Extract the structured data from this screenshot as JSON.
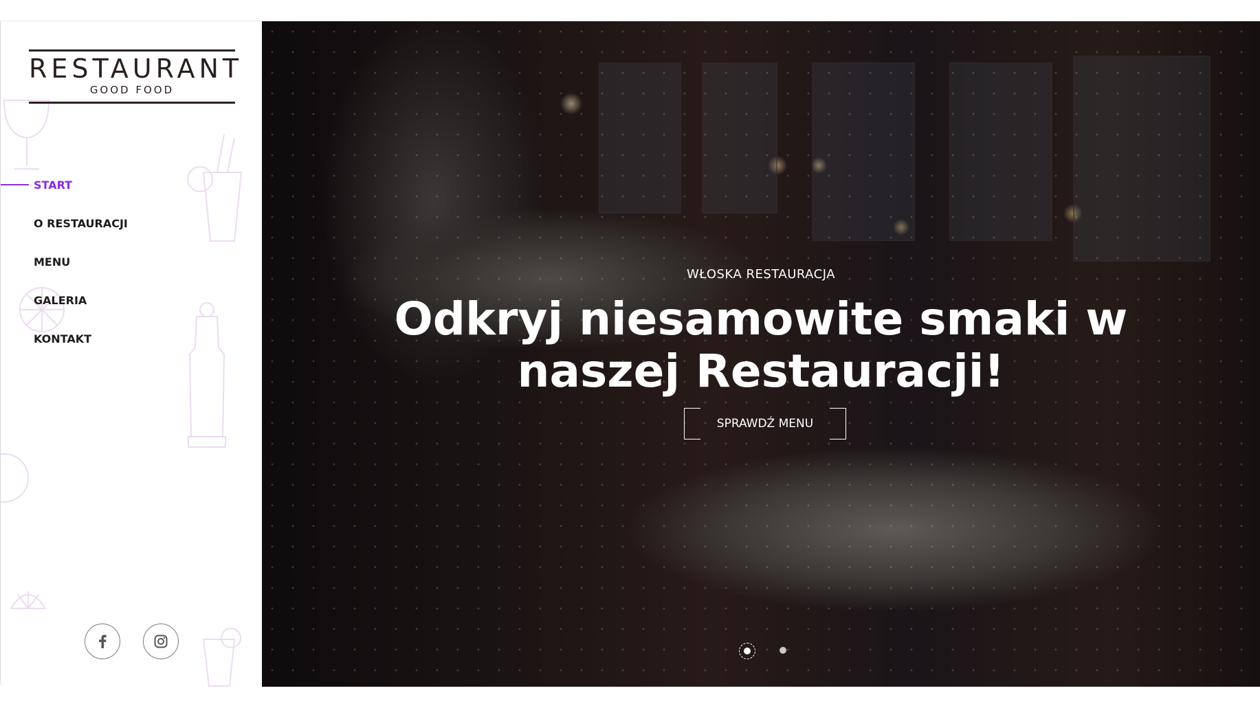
{
  "brand": {
    "name": "RESTAURANT",
    "tagline": "GOOD FOOD"
  },
  "nav": {
    "items": [
      {
        "label": "START",
        "active": true
      },
      {
        "label": "O RESTAURACJI",
        "active": false
      },
      {
        "label": "MENU",
        "active": false
      },
      {
        "label": "GALERIA",
        "active": false
      },
      {
        "label": "KONTAKT",
        "active": false
      }
    ]
  },
  "social": {
    "items": [
      {
        "icon": "facebook-icon"
      },
      {
        "icon": "instagram-icon"
      }
    ]
  },
  "hero": {
    "subtitle": "WŁOSKA RESTAURACJA",
    "headline": "Odkryj niesamowite smaki w naszej Restauracji!",
    "cta_label": "SPRAWDŹ MENU",
    "slides_count": 2,
    "active_slide": 1
  },
  "colors": {
    "accent": "#8a2be2",
    "text_dark": "#1c1c1c",
    "logo": "#2a1f1f"
  }
}
